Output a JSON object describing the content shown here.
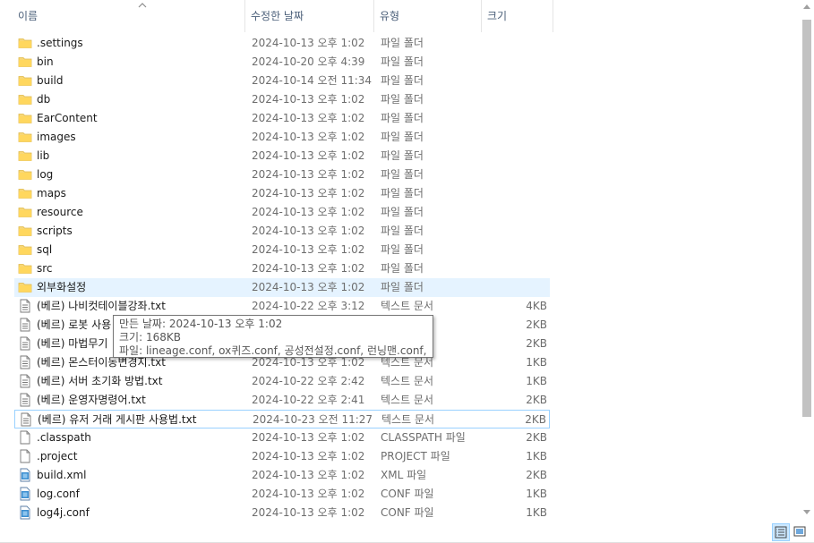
{
  "columns": {
    "name": "이름",
    "date": "수정한 날짜",
    "type": "유형",
    "size": "크기"
  },
  "files": [
    {
      "name": ".settings",
      "date": "2024-10-13 오후 1:02",
      "type": "파일 폴더",
      "size": "",
      "icon": "folder-icon"
    },
    {
      "name": "bin",
      "date": "2024-10-20 오후 4:39",
      "type": "파일 폴더",
      "size": "",
      "icon": "folder-icon"
    },
    {
      "name": "build",
      "date": "2024-10-14 오전 11:34",
      "type": "파일 폴더",
      "size": "",
      "icon": "folder-icon"
    },
    {
      "name": "db",
      "date": "2024-10-13 오후 1:02",
      "type": "파일 폴더",
      "size": "",
      "icon": "folder-icon"
    },
    {
      "name": "EarContent",
      "date": "2024-10-13 오후 1:02",
      "type": "파일 폴더",
      "size": "",
      "icon": "folder-icon"
    },
    {
      "name": "images",
      "date": "2024-10-13 오후 1:02",
      "type": "파일 폴더",
      "size": "",
      "icon": "folder-icon"
    },
    {
      "name": "lib",
      "date": "2024-10-13 오후 1:02",
      "type": "파일 폴더",
      "size": "",
      "icon": "folder-icon"
    },
    {
      "name": "log",
      "date": "2024-10-13 오후 1:02",
      "type": "파일 폴더",
      "size": "",
      "icon": "folder-icon"
    },
    {
      "name": "maps",
      "date": "2024-10-13 오후 1:02",
      "type": "파일 폴더",
      "size": "",
      "icon": "folder-icon"
    },
    {
      "name": "resource",
      "date": "2024-10-13 오후 1:02",
      "type": "파일 폴더",
      "size": "",
      "icon": "folder-icon"
    },
    {
      "name": "scripts",
      "date": "2024-10-13 오후 1:02",
      "type": "파일 폴더",
      "size": "",
      "icon": "folder-icon"
    },
    {
      "name": "sql",
      "date": "2024-10-13 오후 1:02",
      "type": "파일 폴더",
      "size": "",
      "icon": "folder-icon"
    },
    {
      "name": "src",
      "date": "2024-10-13 오후 1:02",
      "type": "파일 폴더",
      "size": "",
      "icon": "folder-icon"
    },
    {
      "name": "외부화설정",
      "date": "2024-10-13 오후 1:02",
      "type": "파일 폴더",
      "size": "",
      "icon": "folder-icon"
    },
    {
      "name": "(베르) 나비컷테이블강좌.txt",
      "date": "2024-10-22 오후 3:12",
      "type": "텍스트 문서",
      "size": "4KB",
      "icon": "text-file-icon"
    },
    {
      "name": "(베르) 로봇 사용",
      "date": "",
      "type": "",
      "size": "2KB",
      "icon": "text-file-icon"
    },
    {
      "name": "(베르) 마법무기",
      "date": "",
      "type": "",
      "size": "2KB",
      "icon": "text-file-icon"
    },
    {
      "name": "(베르) 몬스터이동변경지.txt",
      "date": "2024-10-13 오후 1:02",
      "type": "텍스트 문서",
      "size": "1KB",
      "icon": "text-file-icon"
    },
    {
      "name": "(베르) 서버 초기화 방법.txt",
      "date": "2024-10-22 오후 2:42",
      "type": "텍스트 문서",
      "size": "1KB",
      "icon": "text-file-icon"
    },
    {
      "name": "(베르) 운영자명령어.txt",
      "date": "2024-10-22 오후 2:41",
      "type": "텍스트 문서",
      "size": "2KB",
      "icon": "text-file-icon"
    },
    {
      "name": "(베르) 유저 거래 게시판 사용법.txt",
      "date": "2024-10-23 오전 11:27",
      "type": "텍스트 문서",
      "size": "2KB",
      "icon": "text-file-icon"
    },
    {
      "name": ".classpath",
      "date": "2024-10-13 오후 1:02",
      "type": "CLASSPATH 파일",
      "size": "2KB",
      "icon": "blank-file-icon"
    },
    {
      "name": ".project",
      "date": "2024-10-13 오후 1:02",
      "type": "PROJECT 파일",
      "size": "1KB",
      "icon": "blank-file-icon"
    },
    {
      "name": "build.xml",
      "date": "2024-10-13 오후 1:02",
      "type": "XML 파일",
      "size": "2KB",
      "icon": "xml-file-icon"
    },
    {
      "name": "log.conf",
      "date": "2024-10-13 오후 1:02",
      "type": "CONF 파일",
      "size": "1KB",
      "icon": "conf-file-icon"
    },
    {
      "name": "log4j.conf",
      "date": "2024-10-13 오후 1:02",
      "type": "CONF 파일",
      "size": "1KB",
      "icon": "conf-file-icon"
    }
  ],
  "tooltip": {
    "line1": "만든 날짜: 2024-10-13 오후 1:02",
    "line2": "크기: 168KB",
    "line3": "파일: lineage.conf, ox퀴즈.conf, 공성전설정.conf, 런닝맨.conf, ..."
  },
  "state": {
    "hover_row": "외부화설정",
    "focus_row": "(베르) 유저 거래 게시판 사용법.txt",
    "scroll_fraction": 0.0
  },
  "colors": {
    "header_text": "#4c607a",
    "hover": "#e5f3ff",
    "focus_border": "#99d1ff",
    "folder": "#f8d775",
    "secondary_text": "#6d6d6d"
  }
}
